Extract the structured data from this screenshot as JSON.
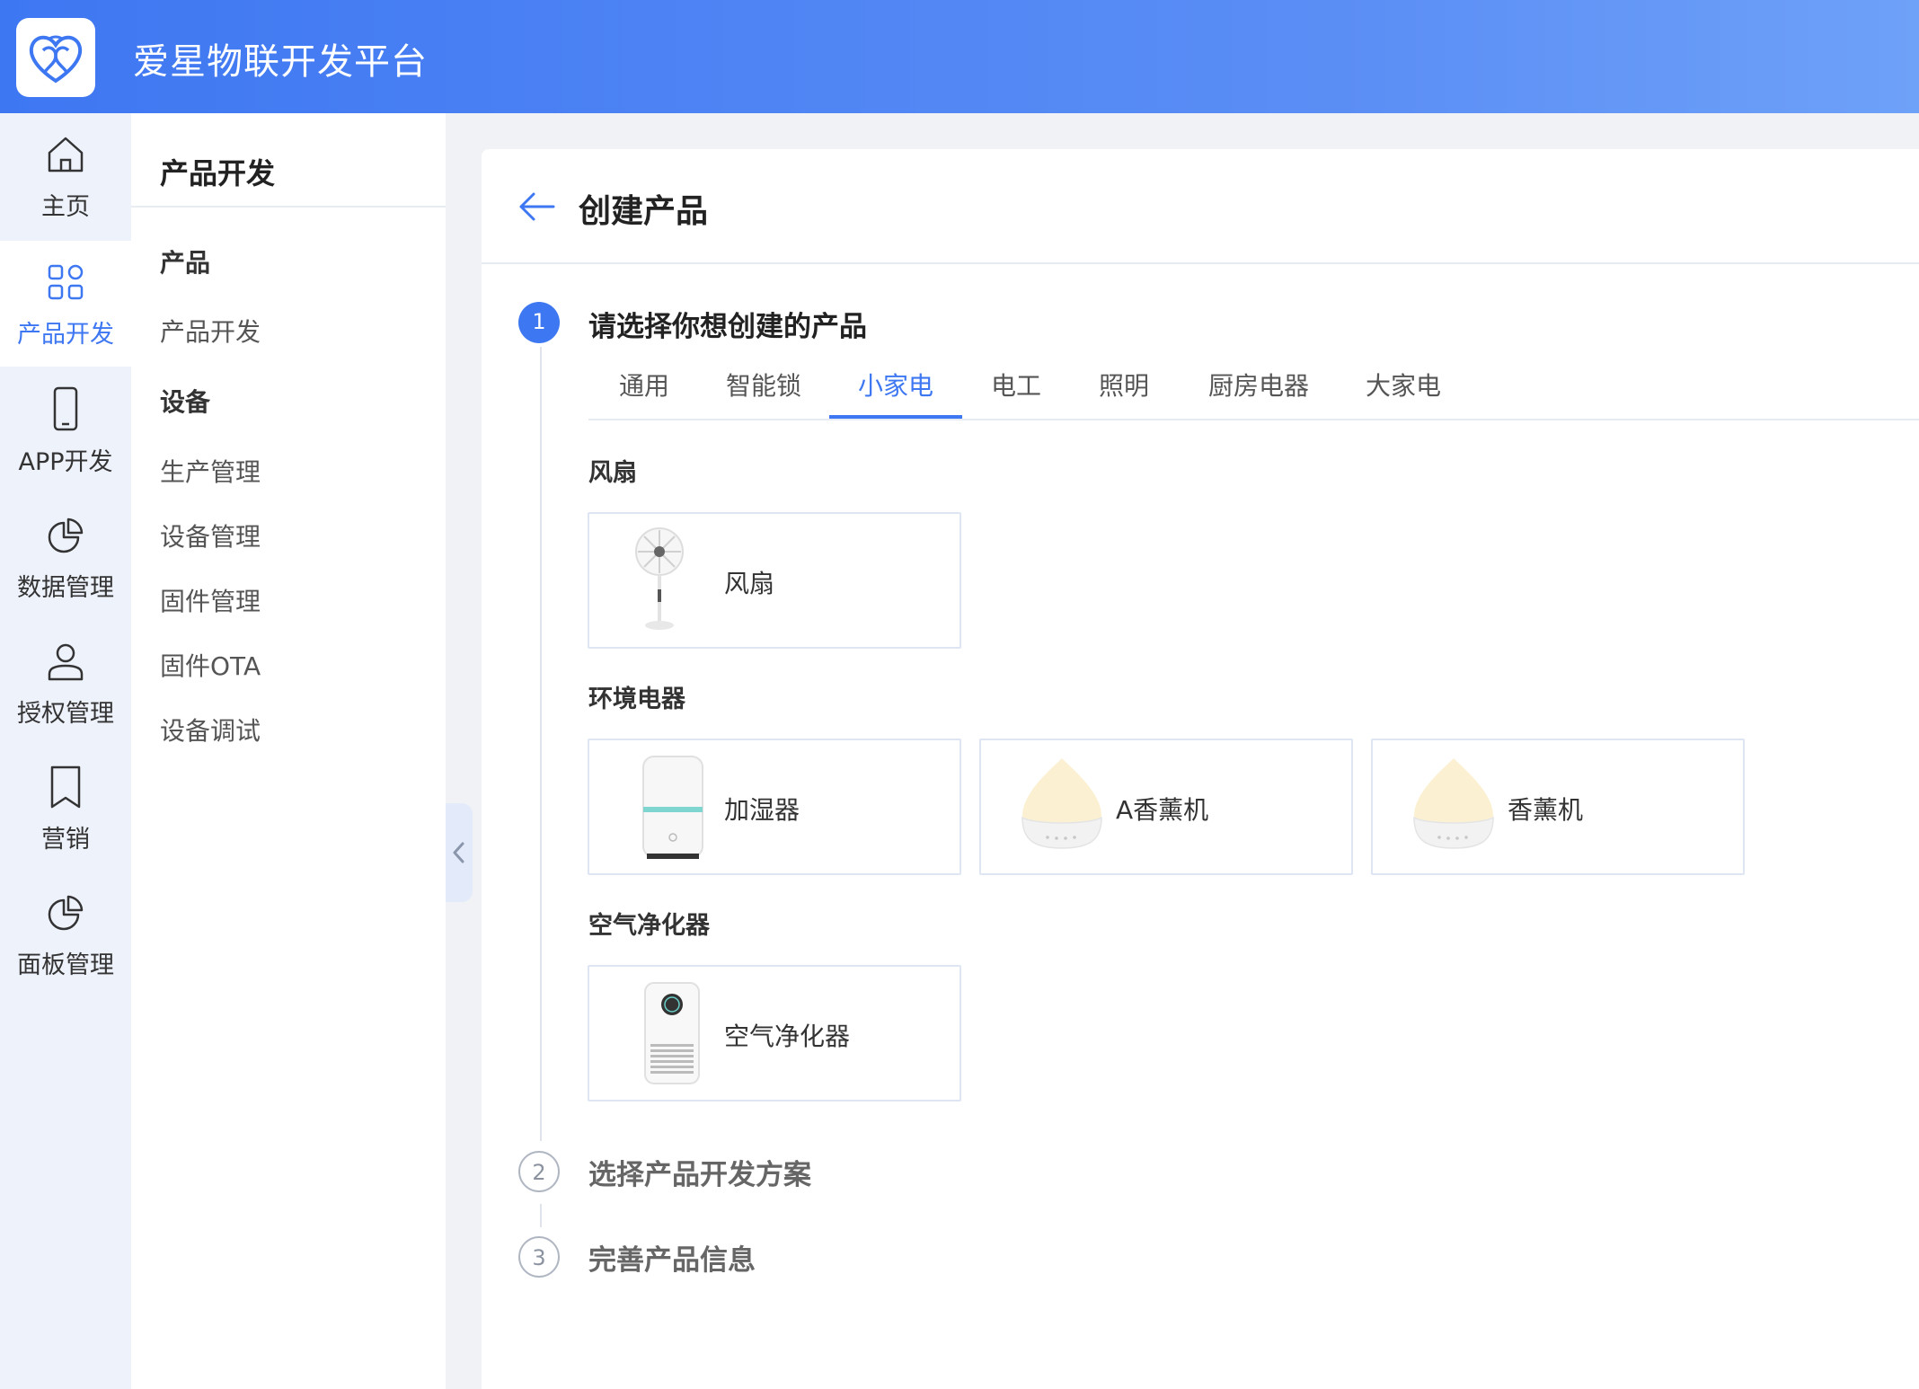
{
  "app": {
    "title": "爱星物联开发平台"
  },
  "rail": [
    {
      "label": "主页",
      "icon": "home-icon",
      "active": false
    },
    {
      "label": "产品开发",
      "icon": "grid-icon",
      "active": true
    },
    {
      "label": "APP开发",
      "icon": "phone-icon",
      "active": false
    },
    {
      "label": "数据管理",
      "icon": "pie-chart-icon",
      "active": false
    },
    {
      "label": "授权管理",
      "icon": "user-icon",
      "active": false
    },
    {
      "label": "营销",
      "icon": "bookmark-icon",
      "active": false
    },
    {
      "label": "面板管理",
      "icon": "pie-chart-icon",
      "active": false
    }
  ],
  "subnav": {
    "title": "产品开发",
    "groups": [
      {
        "label": "产品",
        "items": [
          "产品开发"
        ]
      },
      {
        "label": "设备",
        "items": [
          "生产管理",
          "设备管理",
          "固件管理",
          "固件OTA",
          "设备调试"
        ]
      }
    ]
  },
  "page": {
    "title": "创建产品"
  },
  "steps": [
    {
      "num": "1",
      "title": "请选择你想创建的产品",
      "state": "active"
    },
    {
      "num": "2",
      "title": "选择产品开发方案",
      "state": "todo"
    },
    {
      "num": "3",
      "title": "完善产品信息",
      "state": "todo"
    }
  ],
  "tabs": {
    "items": [
      "通用",
      "智能锁",
      "小家电",
      "电工",
      "照明",
      "厨房电器",
      "大家电"
    ],
    "active": "小家电"
  },
  "categories": [
    {
      "title": "风扇",
      "products": [
        "风扇"
      ]
    },
    {
      "title": "环境电器",
      "products": [
        "加湿器",
        "A香薰机",
        "香薰机"
      ]
    },
    {
      "title": "空气净化器",
      "products": [
        "空气净化器"
      ]
    }
  ],
  "colors": {
    "primary": "#3e77f2",
    "header_gradient_end": "#6ea1f8",
    "rail_bg": "#eef2fb"
  }
}
